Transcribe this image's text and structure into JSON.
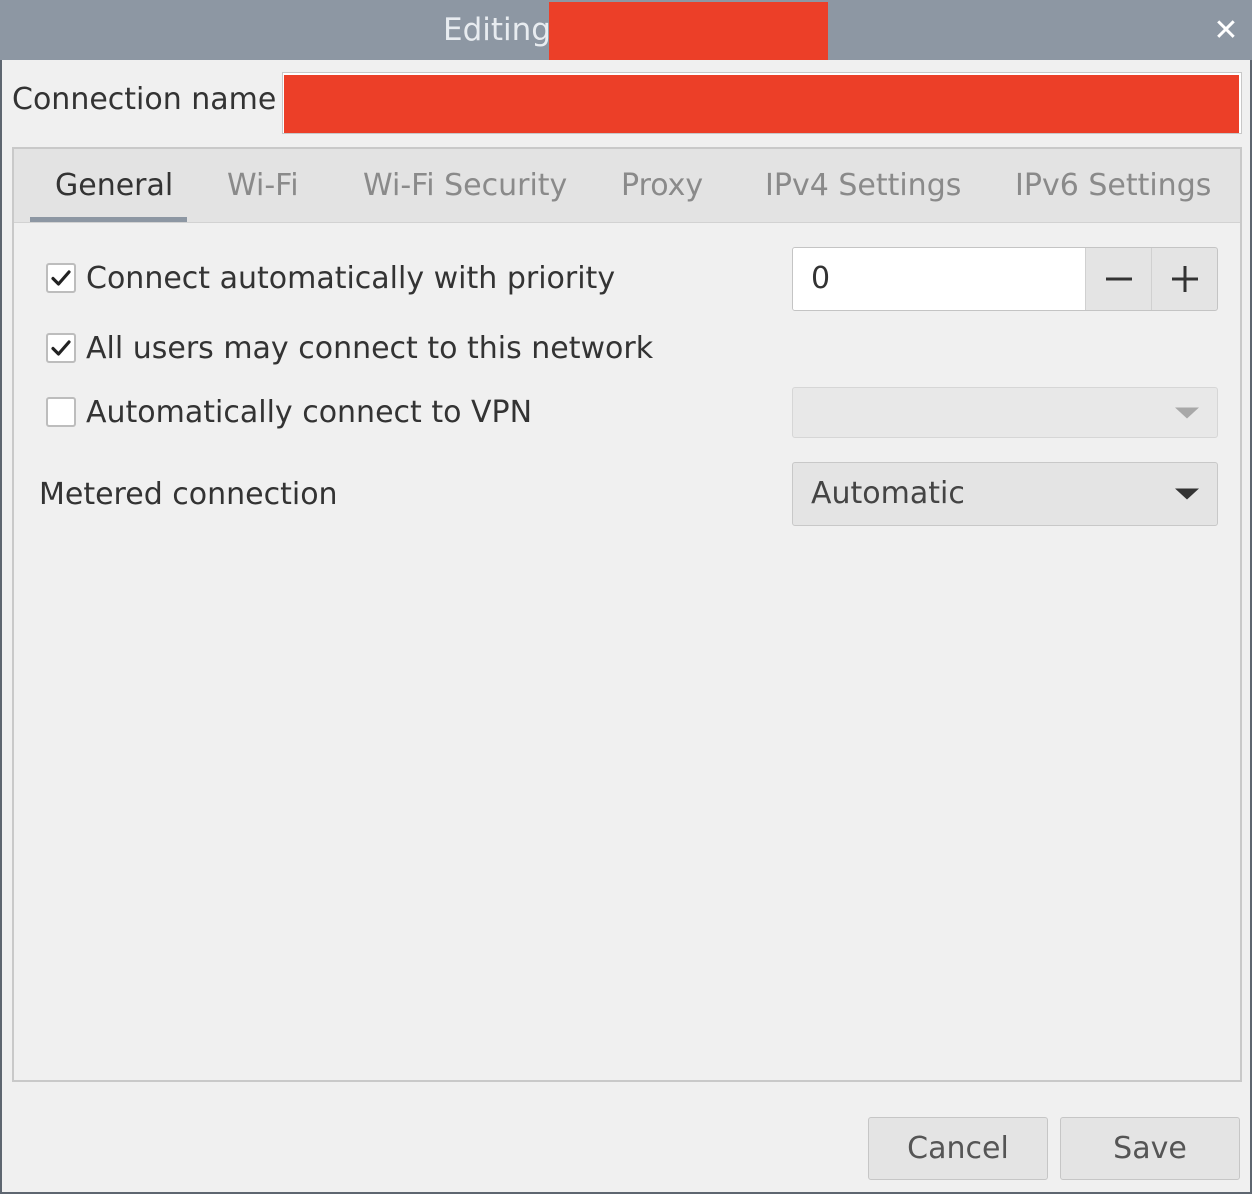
{
  "window": {
    "title": "Editing",
    "close_glyph": "✕"
  },
  "connection": {
    "label": "Connection name",
    "value": ""
  },
  "tabs": [
    {
      "label": "General",
      "active": true
    },
    {
      "label": "Wi-Fi",
      "active": false
    },
    {
      "label": "Wi-Fi Security",
      "active": false
    },
    {
      "label": "Proxy",
      "active": false
    },
    {
      "label": "IPv4 Settings",
      "active": false
    },
    {
      "label": "IPv6 Settings",
      "active": false
    }
  ],
  "general": {
    "auto_connect": {
      "label": "Connect automatically with priority",
      "checked": true
    },
    "priority_value": "0",
    "all_users": {
      "label": "All users may connect to this network",
      "checked": true
    },
    "auto_vpn": {
      "label": "Automatically connect to VPN",
      "checked": false
    },
    "vpn_selected": "",
    "metered_label": "Metered connection",
    "metered_value": "Automatic"
  },
  "buttons": {
    "cancel": "Cancel",
    "save": "Save"
  },
  "colors": {
    "titlebar": "#8d97a3",
    "redaction": "#ec3f28",
    "background": "#f0f0f0"
  }
}
